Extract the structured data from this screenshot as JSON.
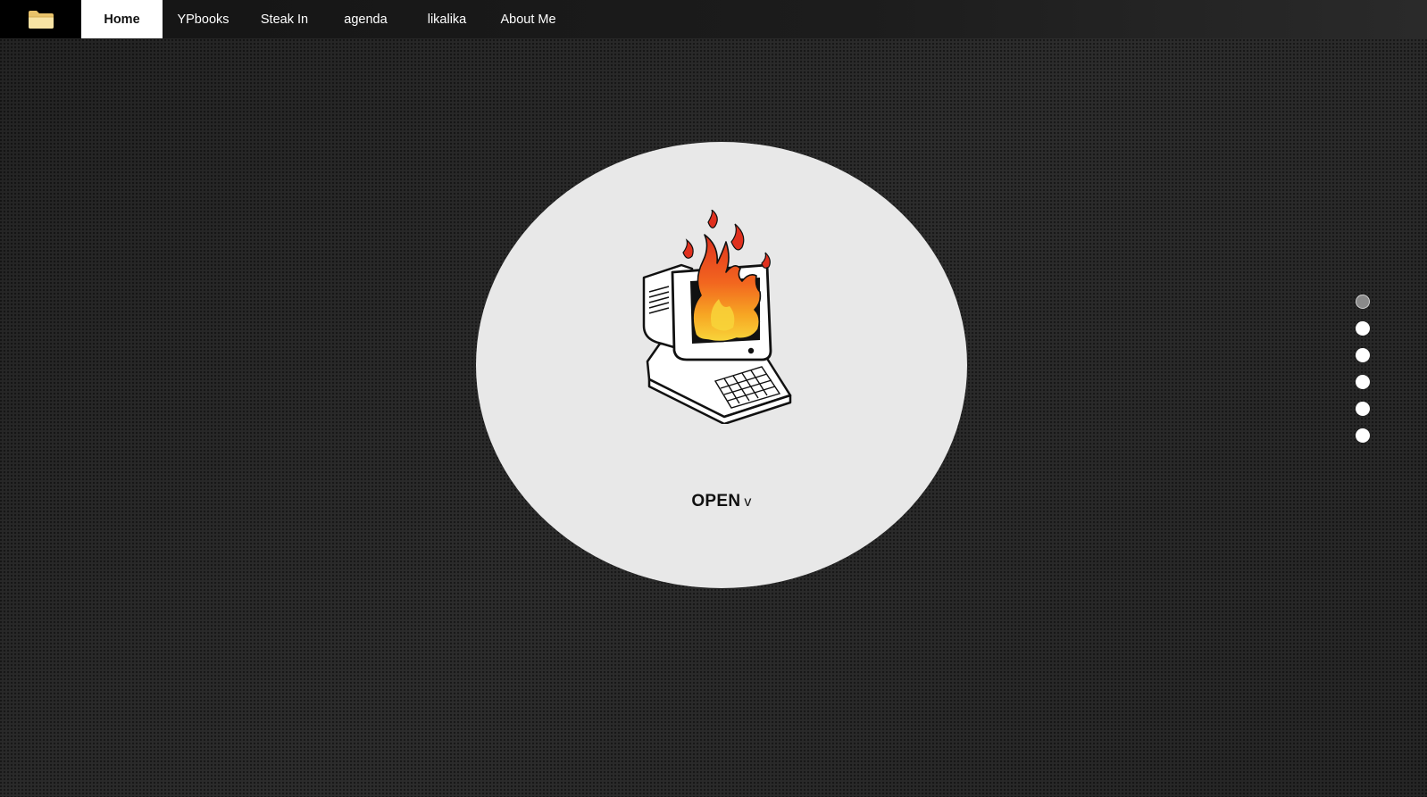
{
  "nav": {
    "items": [
      {
        "label": "Home",
        "active": true
      },
      {
        "label": "YPbooks",
        "active": false
      },
      {
        "label": "Steak In",
        "active": false
      },
      {
        "label": "agenda",
        "active": false
      },
      {
        "label": "likalika",
        "active": false
      },
      {
        "label": "About Me",
        "active": false
      }
    ]
  },
  "hero": {
    "open_label": "OPEN",
    "open_chevron": "v",
    "icon": "computer-on-fire-illustration"
  },
  "pagination": {
    "count": 6,
    "active_index": 0
  },
  "colors": {
    "page_background": "#2a2a2a",
    "hero_circle": "#e8e8e8",
    "nav_active_bg": "#ffffff",
    "folder_icon": "#f3d98b"
  }
}
